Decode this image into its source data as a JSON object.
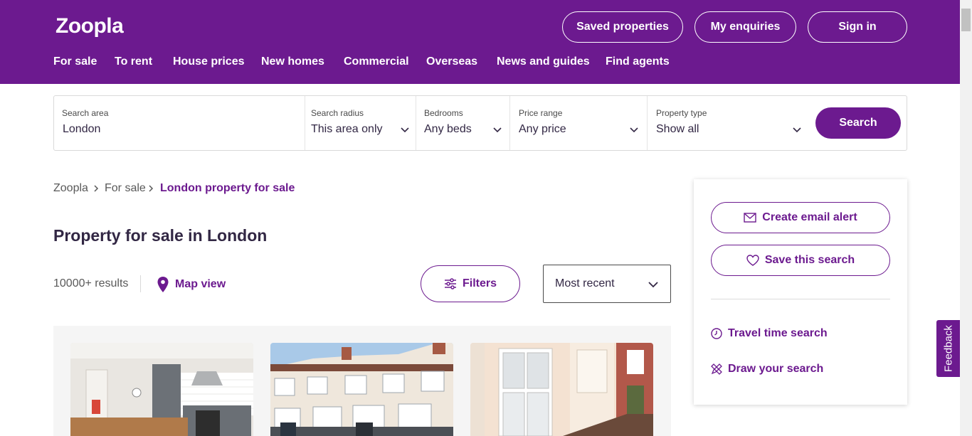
{
  "header": {
    "logo": "Zoopla",
    "buttons": {
      "saved": "Saved properties",
      "enquiries": "My enquiries",
      "signin": "Sign in"
    },
    "nav": [
      "For sale",
      "To rent",
      "House prices",
      "New homes",
      "Commercial",
      "Overseas",
      "News and guides",
      "Find agents"
    ]
  },
  "search": {
    "area_label": "Search area",
    "area_value": "London",
    "radius_label": "Search radius",
    "radius_value": "This area only",
    "beds_label": "Bedrooms",
    "beds_value": "Any beds",
    "price_label": "Price range",
    "price_value": "Any price",
    "type_label": "Property type",
    "type_value": "Show all",
    "button": "Search"
  },
  "breadcrumb": [
    "Zoopla",
    "For sale",
    "London property for sale"
  ],
  "page_title": "Property for sale in London",
  "results": {
    "count": "10000+ results",
    "map_view": "Map view",
    "filters": "Filters",
    "sort": "Most recent"
  },
  "sidebar": {
    "email_alert": "Create email alert",
    "save_search": "Save this search",
    "travel_time": "Travel time search",
    "draw_search": "Draw your search"
  },
  "feedback": "Feedback",
  "colors": {
    "brand": "#6c1a8f",
    "text": "#322744"
  }
}
